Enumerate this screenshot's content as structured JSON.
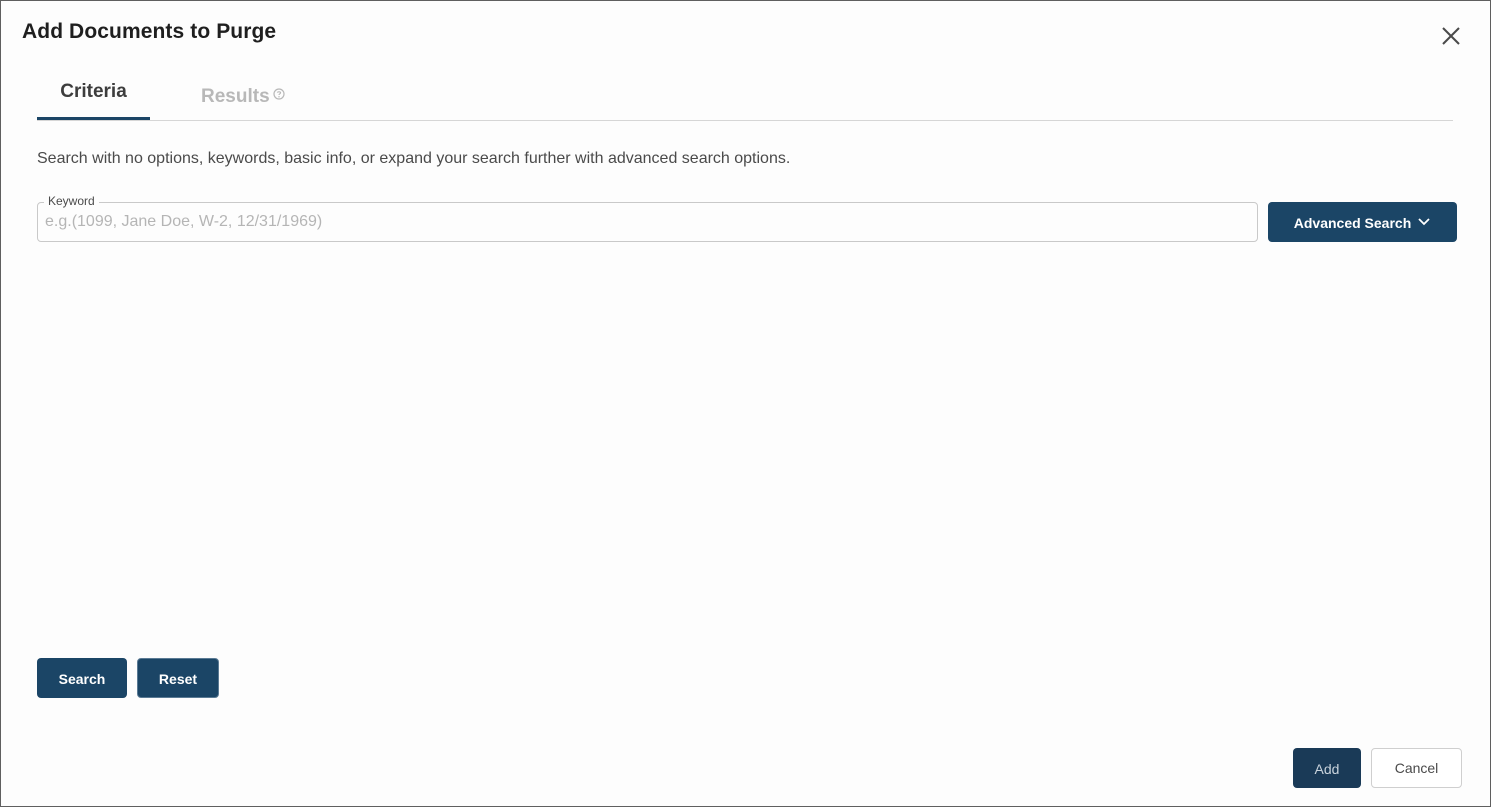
{
  "dialog": {
    "title": "Add Documents to Purge",
    "close_icon": "close-icon"
  },
  "tabs": [
    {
      "label": "Criteria",
      "active": true
    },
    {
      "label": "Results",
      "active": false,
      "icon": "help-circle-icon"
    }
  ],
  "criteria": {
    "description": "Search with no options, keywords, basic info, or expand your search further with advanced search options.",
    "keyword": {
      "label": "Keyword",
      "value": "",
      "placeholder": "e.g.(1099, Jane Doe, W-2, 12/31/1969)"
    },
    "advanced_search_label": "Advanced Search",
    "advanced_search_icon": "chevron-down-icon",
    "search_label": "Search",
    "reset_label": "Reset"
  },
  "footer": {
    "add_label": "Add",
    "cancel_label": "Cancel"
  },
  "colors": {
    "primary": "#1b4566",
    "inactive_tab": "#b8b8b8",
    "border": "#d6d6d6"
  }
}
